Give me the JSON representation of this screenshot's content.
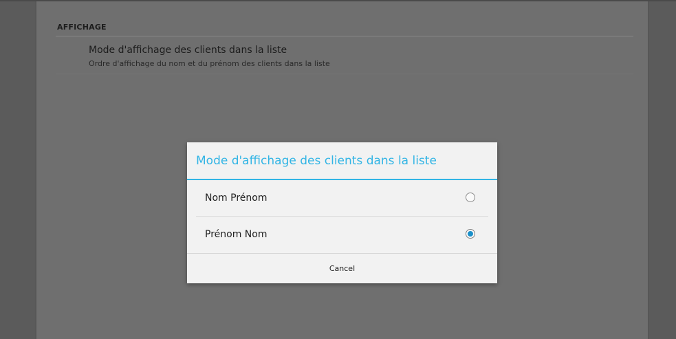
{
  "settings": {
    "section_header": "AFFICHAGE",
    "preference": {
      "title": "Mode d'affichage des clients dans la liste",
      "summary": "Ordre d'affichage du nom et du prénom des clients dans la liste"
    }
  },
  "dialog": {
    "title": "Mode d'affichage des clients dans la liste",
    "options": [
      {
        "label": "Nom Prénom",
        "selected": false
      },
      {
        "label": "Prénom Nom",
        "selected": true
      }
    ],
    "cancel_label": "Cancel",
    "accent_color": "#33b5e5"
  }
}
